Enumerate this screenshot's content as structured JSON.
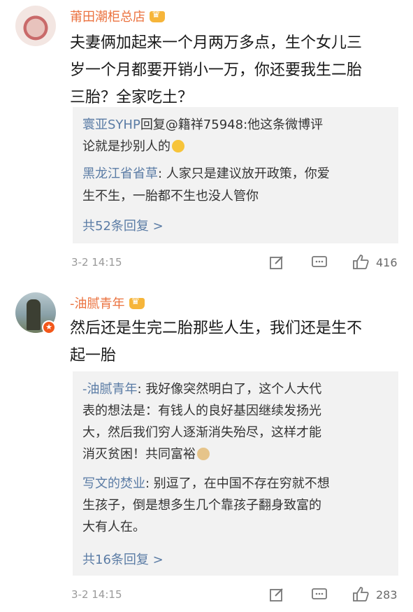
{
  "comments": [
    {
      "username": "莆田潮柜总店",
      "text": [
        "夫妻俩加起来一个月两万多点，生个女儿三",
        "岁一个月都要开销小一万，你还要我生二胎",
        "三胎？全家吃土？"
      ],
      "replies": [
        {
          "name": "寰亚SYHP",
          "body": [
            "回复@籍祥75948:他这条微博评",
            "论就是抄别人的"
          ]
        },
        {
          "name": "黑龙江省省草",
          "body": [
            ": 人家只是建议放开政策，你爱",
            "生不生，一胎都不生也没人管你"
          ]
        }
      ],
      "more": "共52条回复 >",
      "time": "3-2 14:15",
      "likes": "416"
    },
    {
      "username": "-油腻青年",
      "text": [
        "然后还是生完二胎那些人生，我们还是生不",
        "起一胎"
      ],
      "replies": [
        {
          "name": "-油腻青年",
          "body": [
            ": 我好像突然明白了，这个人大代",
            "表的想法是：有钱人的良好基因继续发扬光",
            "大，然后我们穷人逐渐消失殆尽，这样才能",
            "消灭贫困！共同富裕"
          ]
        },
        {
          "name": "写文的焚业",
          "body": [
            ": 别逗了，在中国不存在穷就不想",
            "生孩子，倒是想多生几个靠孩子翻身致富的",
            "大有人在。"
          ]
        }
      ],
      "more": "共16条回复 >",
      "time": "3-2 14:15",
      "likes": "283"
    }
  ],
  "icons": {
    "edit": "edit-icon",
    "comment": "comment-icon",
    "like": "thumbs-up-icon",
    "crown": "vip-crown-icon",
    "laugh": "laugh-emoji",
    "dog": "dog-emoji"
  },
  "colors": {
    "username": "#eb7340",
    "reply_name": "#5b7ca5",
    "reply_bg": "#f2f2f2",
    "meta": "#9a9a9a"
  }
}
